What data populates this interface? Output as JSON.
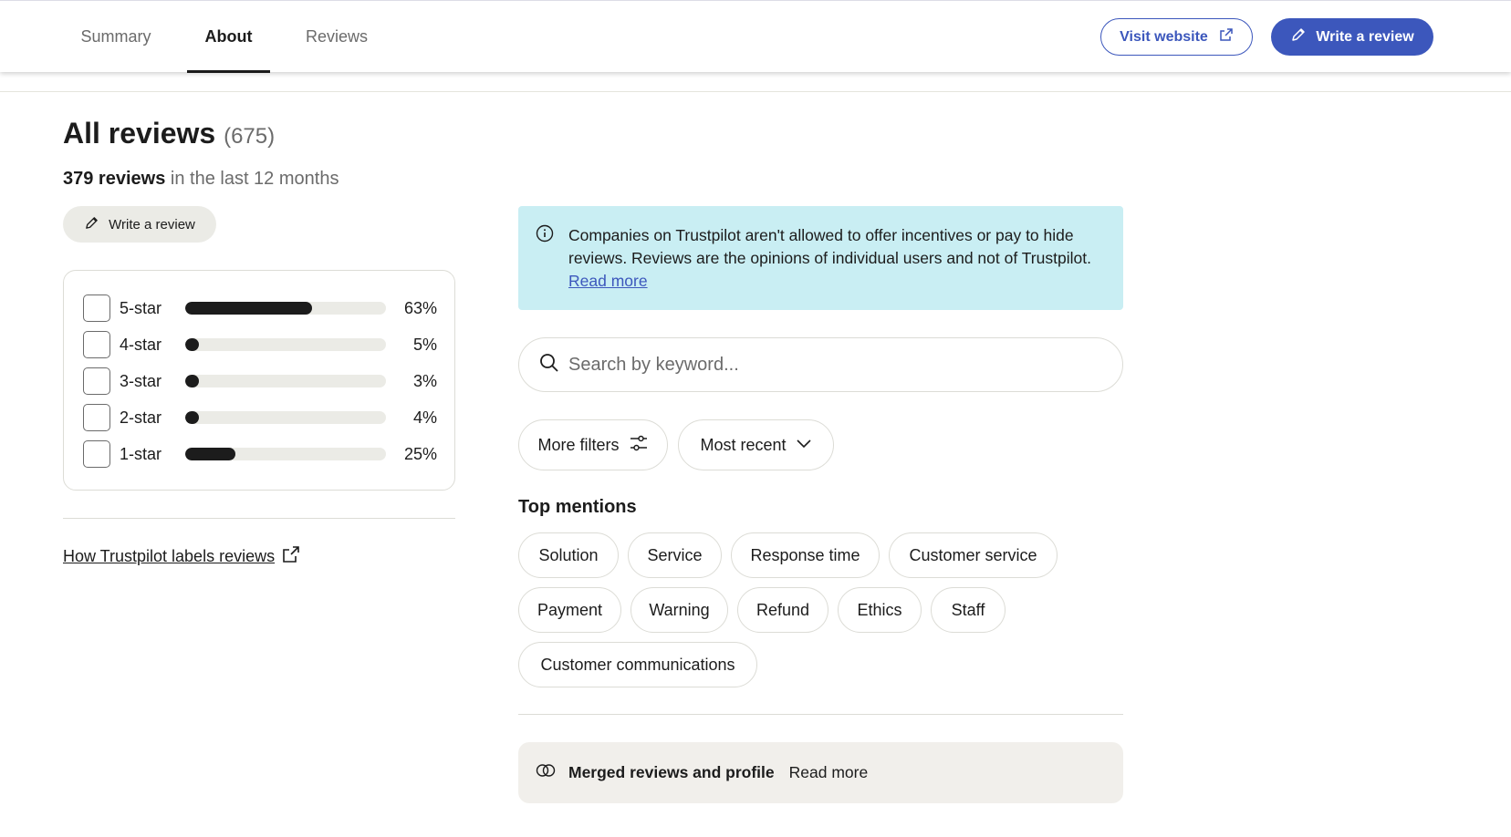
{
  "tabs": [
    {
      "label": "Summary",
      "active": false
    },
    {
      "label": "About",
      "active": true
    },
    {
      "label": "Reviews",
      "active": false
    }
  ],
  "header": {
    "visit_website": "Visit website",
    "write_review": "Write a review"
  },
  "reviews_summary": {
    "title": "All reviews",
    "total_count": "(675)",
    "recent_count": "379 reviews",
    "recent_period": "in the last 12 months",
    "write_review": "Write a review"
  },
  "distribution": [
    {
      "label": "5-star",
      "percent_text": "63%",
      "fraction": 0.63
    },
    {
      "label": "4-star",
      "percent_text": "5%",
      "fraction": 0.05
    },
    {
      "label": "3-star",
      "percent_text": "3%",
      "fraction": 0.03
    },
    {
      "label": "2-star",
      "percent_text": "4%",
      "fraction": 0.04
    },
    {
      "label": "1-star",
      "percent_text": "25%",
      "fraction": 0.25
    }
  ],
  "labels_link": "How Trustpilot labels reviews",
  "notice": {
    "text": "Companies on Trustpilot aren't allowed to offer incentives or pay to hide reviews. Reviews are the opinions of individual users and not of Trustpilot.",
    "link": "Read more"
  },
  "search": {
    "placeholder": "Search by keyword..."
  },
  "filters": {
    "more_filters": "More filters",
    "sort": "Most recent"
  },
  "top_mentions": {
    "title": "Top mentions",
    "chips": [
      "Solution",
      "Service",
      "Response time",
      "Customer service",
      "Payment",
      "Warning",
      "Refund",
      "Ethics",
      "Staff",
      "Customer communications"
    ]
  },
  "merged": {
    "title": "Merged reviews and profile",
    "link": "Read more"
  },
  "colors": {
    "brand_blue": "#3c57bc",
    "notice_bg": "#c9eef3",
    "bar_fill": "#1c1c1c",
    "bar_track": "#ebebe6"
  }
}
